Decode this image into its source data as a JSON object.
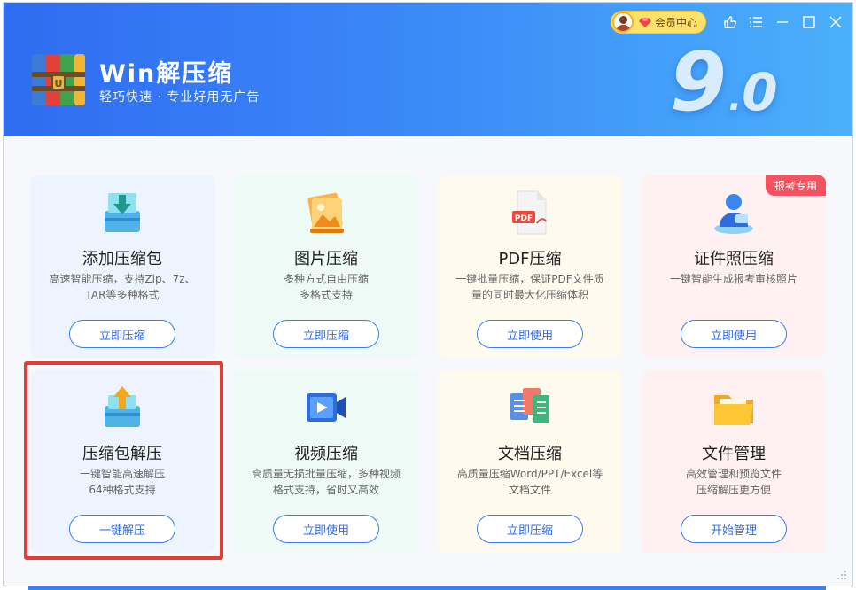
{
  "app": {
    "name": "Win解压缩",
    "tagline": "轻巧快速 · 专业好用无广告",
    "version_major": "9",
    "version_dot": ".",
    "version_minor": "0"
  },
  "titlebar": {
    "member_label": "会员中心",
    "controls": [
      "thumbs-up-icon",
      "menu-icon",
      "minimize-icon",
      "maximize-icon",
      "close-icon"
    ]
  },
  "colors": {
    "header_start": "#2f6cf0",
    "header_end": "#4ab0fb",
    "accent": "#3d7bf0",
    "badge": "#f6515f",
    "highlight": "#e33b35"
  },
  "cards": [
    {
      "title": "添加压缩包",
      "desc_line1": "高速智能压缩，支持Zip、7z、",
      "desc_line2": "TAR等多种格式",
      "button": "立即压缩",
      "icon": "add-archive-icon"
    },
    {
      "title": "图片压缩",
      "desc_line1": "多种方式自由压缩",
      "desc_line2": "多格式支持",
      "button": "立即压缩",
      "icon": "image-icon"
    },
    {
      "title": "PDF压缩",
      "desc_line1": "一键批量压缩，保证PDF文件质",
      "desc_line2": "量的同时最大化压缩体积",
      "button": "立即使用",
      "icon": "pdf-icon"
    },
    {
      "title": "证件照压缩",
      "desc_line1": "一键智能生成报考审核照片",
      "desc_line2": "",
      "button": "立即使用",
      "icon": "id-photo-icon",
      "badge": "报考专用"
    },
    {
      "title": "压缩包解压",
      "desc_line1": "一键智能高速解压",
      "desc_line2": "64种格式支持",
      "button": "一键解压",
      "icon": "extract-icon"
    },
    {
      "title": "视频压缩",
      "desc_line1": "高质量无损批量压缩，多种视频",
      "desc_line2": "格式支持，省时又高效",
      "button": "立即使用",
      "icon": "video-icon"
    },
    {
      "title": "文档压缩",
      "desc_line1": "高质量压缩Word/PPT/Excel等",
      "desc_line2": "文档文件",
      "button": "立即压缩",
      "icon": "document-icon"
    },
    {
      "title": "文件管理",
      "desc_line1": "高效管理和预览文件",
      "desc_line2": "压缩解压更方便",
      "button": "开始管理",
      "icon": "folder-icon"
    }
  ]
}
